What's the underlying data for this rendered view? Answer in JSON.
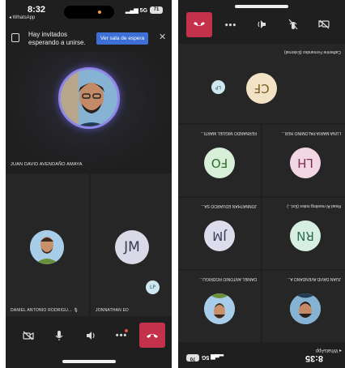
{
  "left_screen": {
    "status": {
      "time": "8:32",
      "back_label": "◂ WhatsApp",
      "network": "5G",
      "battery": "71"
    },
    "lobby_banner": {
      "text": "Hay invitados esperando a unirse.",
      "button": "Ver sala de espera"
    },
    "main_participant": {
      "name": "JUAN DAVID AVENDAÑO AMAYA"
    },
    "participants": [
      {
        "name": "DANIEL ANTONIO RODRIGU...",
        "mic_glyph": "🎙"
      },
      {
        "name": "JONNATHAN ED",
        "initials": "JM"
      }
    ],
    "corner_badge": "LP",
    "toolbar": {
      "camera": "camera-off",
      "mic": "mic",
      "speaker": "speaker",
      "more": "more",
      "hangup": "hang-up"
    }
  },
  "right_screen": {
    "status": {
      "time": "8:35",
      "back_label": "◂ WhatsApp",
      "network": "5G",
      "battery": "70"
    },
    "tiles": [
      {
        "name": "JUAN DAVID AVENDAÑO A...",
        "type": "photo"
      },
      {
        "name": "DANIEL ANTONIO RODRIGU...",
        "type": "photo"
      },
      {
        "name": "Read AI meeting notes (Ext...)",
        "initials": "RN",
        "color": "#d7efe3",
        "text_color": "#2d6a4f"
      },
      {
        "name": "JONNATHAN EDUARDO SA...",
        "initials": "JM",
        "color": "#dcdcec",
        "text_color": "#3a3a55"
      },
      {
        "name": "LUNA MARIA PALOMINO HER...",
        "initials": "LH",
        "color": "#f3d6e4",
        "text_color": "#7a2c4e"
      },
      {
        "name": "FERNANDO MIGUEL MARTI...",
        "initials": "FO",
        "color": "#d8efd8",
        "text_color": "#2e6b2e"
      },
      {
        "name": "Catherine Fernandez (External)",
        "initials": "CF",
        "color": "#f3e3c6",
        "text_color": "#7a5a1e"
      }
    ],
    "corner_badge": "LP"
  }
}
